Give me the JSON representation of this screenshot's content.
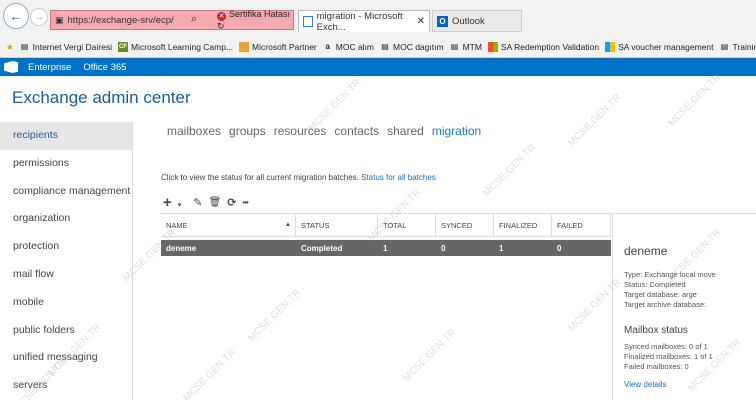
{
  "browser": {
    "url": "https://exchange-srv/ecp/",
    "cert_error": "Sertifika Hatası",
    "tabs": [
      {
        "label": "migration - Microsoft Exch...",
        "active": true
      },
      {
        "label": "Outlook",
        "active": false
      }
    ],
    "favorites": [
      {
        "icon": "internet-vergi-icon",
        "label": "Internet Vergi Dairesi"
      },
      {
        "icon": "cf-icon",
        "label": "Microsoft Learning Camp..."
      },
      {
        "icon": "mp-icon",
        "label": "Microsoft Partner"
      },
      {
        "icon": "amazon-icon",
        "label": "MOC alım"
      },
      {
        "icon": "doc-icon",
        "label": "MOC dagıtım"
      },
      {
        "icon": "doc-icon",
        "label": "MTM"
      },
      {
        "icon": "windows-icon",
        "label": "SA Redemption Validation"
      },
      {
        "icon": "windows-icon",
        "label": "SA voucher management"
      },
      {
        "icon": "doc-icon",
        "label": "Training Catalo"
      }
    ]
  },
  "suite": {
    "items": [
      "Enterprise",
      "Office 365"
    ]
  },
  "app": {
    "title": "Exchange admin center"
  },
  "nav": {
    "items": [
      {
        "label": "recipients",
        "selected": true
      },
      {
        "label": "permissions"
      },
      {
        "label": "compliance management"
      },
      {
        "label": "organization"
      },
      {
        "label": "protection"
      },
      {
        "label": "mail flow"
      },
      {
        "label": "mobile"
      },
      {
        "label": "public folders"
      },
      {
        "label": "unified messaging"
      },
      {
        "label": "servers"
      }
    ]
  },
  "subtabs": [
    "mailboxes",
    "groups",
    "resources",
    "contacts",
    "shared",
    "migration"
  ],
  "info": {
    "text": "Click to view the status for all current migration batches.",
    "link": "Status for all batches"
  },
  "toolbar": {
    "add": "+",
    "add_caret": "▾",
    "edit": "✎",
    "delete": "🗑",
    "refresh": "⟳",
    "more": "•••"
  },
  "table": {
    "columns": [
      "NAME",
      "STATUS",
      "TOTAL",
      "SYNCED",
      "FINALIZED",
      "FAILED"
    ],
    "rows": [
      {
        "name": "deneme",
        "status": "Completed",
        "total": "1",
        "synced": "0",
        "finalized": "1",
        "failed": "0"
      }
    ]
  },
  "details": {
    "title": "deneme",
    "type": "Type: Exchange local move",
    "status": "Status: Completed",
    "target_db": "Target database: arge",
    "target_archive": "Target archive database:",
    "mailbox_status_title": "Mailbox status",
    "synced": "Synced mailboxes: 0 of 1",
    "finalized": "Finalized mailboxes: 1 of 1",
    "failed": "Failed mailboxes: 0",
    "view_details": "View details"
  },
  "watermark": "MCSE.GEN.TR",
  "colors": {
    "suitebar": "#0072c6",
    "title": "#1d5b9c",
    "selected_row": "#666666",
    "address_error": "#f4a8b0"
  }
}
